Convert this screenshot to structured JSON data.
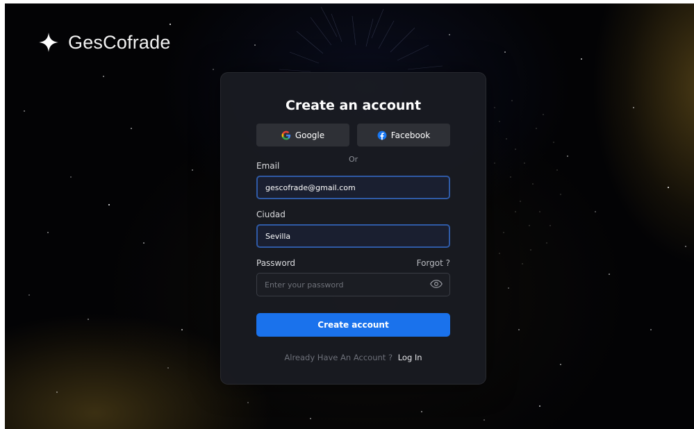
{
  "brand": {
    "name": "GesCofrade",
    "icon": "sparkle-star-icon"
  },
  "card": {
    "title": "Create an account",
    "social": {
      "google_label": "Google",
      "facebook_label": "Facebook"
    },
    "divider_text": "Or",
    "email": {
      "label": "Email",
      "value": "gescofrade@gmail.com"
    },
    "city": {
      "label": "Ciudad",
      "value": "Sevilla"
    },
    "password": {
      "label": "Password",
      "forgot_label": "Forgot ?",
      "value": "",
      "placeholder": "Enter your password",
      "toggle_icon": "eye-icon"
    },
    "submit_label": "Create account",
    "footer": {
      "prompt": "Already Have An Account ?",
      "link_label": "Log In"
    }
  },
  "colors": {
    "background": "#030305",
    "card": "#1a1c22",
    "accent": "#1a72ec",
    "input_focus_border": "#2f5aa6",
    "social_button": "#2e3036"
  }
}
